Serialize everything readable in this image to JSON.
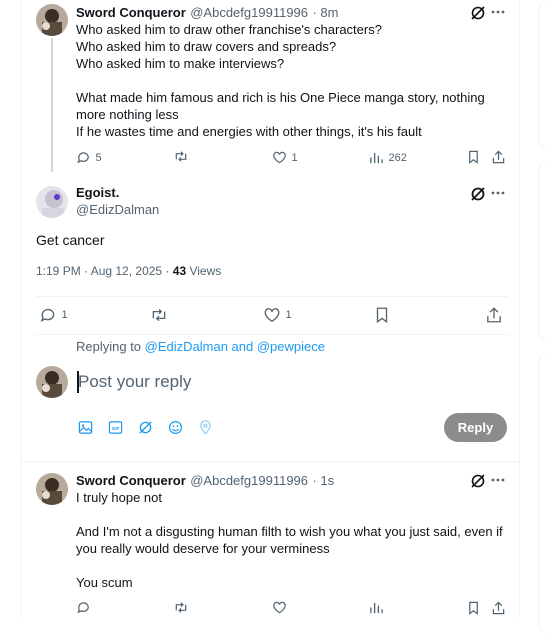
{
  "tweet1": {
    "name": "Sword Conqueror",
    "handle": "@Abcdefg19911996",
    "time": "· 8m",
    "text": "Who asked him to draw other franchise's characters?\nWho asked him to draw covers and spreads?\nWho asked him to make interviews?\n\nWhat made him famous and rich is his One Piece manga story, nothing\nmore nothing less\nIf he wastes time and energies with other things, it's his fault",
    "replies": "5",
    "likes": "1",
    "views": "262"
  },
  "main": {
    "name": "Egoist.",
    "handle": "@EdizDalman",
    "text": "Get cancer",
    "timestamp": "1:19 PM · Aug 12, 2025 · ",
    "views_count": "43",
    "views_label": " Views",
    "replies": "1",
    "likes": "1"
  },
  "reply_box": {
    "replying_to_label": "Replying to ",
    "replying_to_users": "@EdizDalman and @pewpiece",
    "placeholder": "Post your reply",
    "button": "Reply"
  },
  "tweet3": {
    "name": "Sword Conqueror",
    "handle": "@Abcdefg19911996",
    "time": "· 1s",
    "text": "I truly hope not\n\nAnd I'm not a disgusting human filth to wish you what you just said, even if\nyou really would deserve for your verminess\n\nYou scum"
  },
  "colors": {
    "accent": "#1d9bf0",
    "text": "#0f1419",
    "secondary": "#536471",
    "reply_button_bg": "#8c8c8c"
  }
}
